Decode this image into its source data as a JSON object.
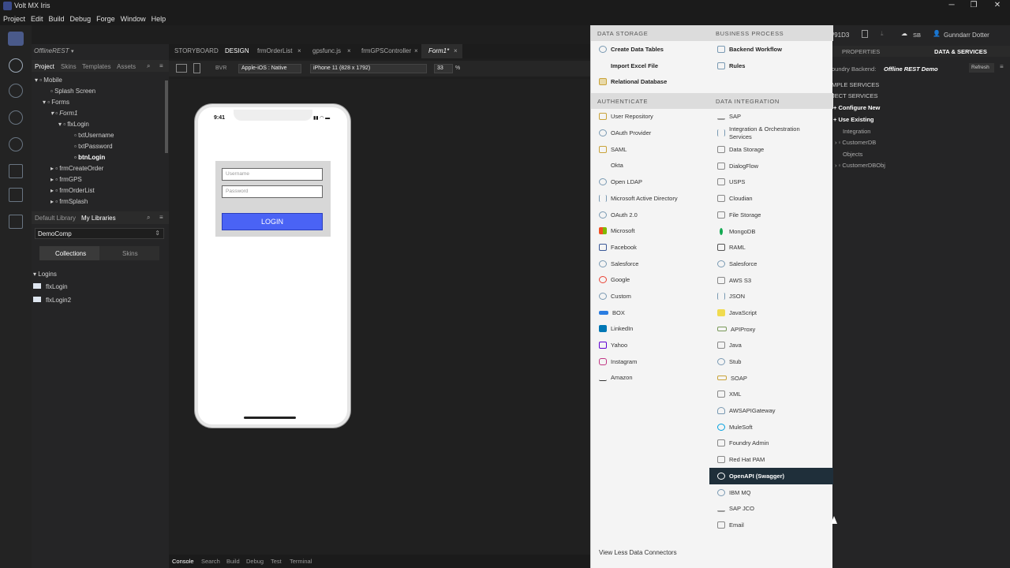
{
  "app": {
    "title": "Volt MX Iris"
  },
  "menu": [
    "Project",
    "Edit",
    "Build",
    "Debug",
    "Forge",
    "Window",
    "Help"
  ],
  "header": {
    "build_id": "/91D3",
    "user_initials": "SB",
    "user_name": "Gunndarr Dotter"
  },
  "project": {
    "name": "OfflineREST"
  },
  "left_tabs": [
    "Project",
    "Skins",
    "Templates",
    "Assets"
  ],
  "tree": [
    "Mobile",
    "Splash Screen",
    "Forms",
    "Form1",
    "flxLogin",
    "txtUsername",
    "txtPassword",
    "btnLogin",
    "frmCreateOrder",
    "frmGPS",
    "frmOrderList",
    "frmSplash"
  ],
  "library_tabs": [
    "Default Library",
    "My Libraries"
  ],
  "library_select": "DemoComp",
  "collection_tabs": [
    "Collections",
    "Skins"
  ],
  "collections": {
    "group": "Logins",
    "items": [
      "flxLogin",
      "flxLogin2"
    ]
  },
  "editor_tabs": [
    "STORYBOARD",
    "DESIGN",
    "frmOrderList",
    "gpsfunc.js",
    "frmGPSController",
    "Form1*"
  ],
  "toolbar": {
    "mode": "BVR",
    "platform": "Apple-iOS : Native",
    "device": "iPhone 11 (828 x 1792)",
    "zoom": "33",
    "zoom_unit": "%"
  },
  "phone": {
    "time": "9:41",
    "username_placeholder": "Username",
    "password_placeholder": "Password",
    "login_label": "LOGIN"
  },
  "bottom_tabs": [
    "Console",
    "Search",
    "Build",
    "Debug",
    "Test",
    "Terminal"
  ],
  "right_panel": {
    "tabs": [
      "PROPERTIES",
      "DATA & SERVICES"
    ],
    "backend_label": "oundry Backend:",
    "backend_name": "Offline REST Demo",
    "refresh": "Refresh",
    "items": [
      "MPLE SERVICES",
      "JECT SERVICES",
      "Configure New",
      "Use Existing",
      "Integration",
      "CustomerDB",
      "Objects",
      "CustomerDBObj"
    ]
  },
  "dropdown": {
    "data_storage": {
      "title": "DATA STORAGE",
      "items": [
        "Create Data Tables",
        "Import Excel File",
        "Relational Database"
      ]
    },
    "business_process": {
      "title": "BUSINESS PROCESS",
      "items": [
        "Backend Workflow",
        "Rules"
      ]
    },
    "authenticate": {
      "title": "AUTHENTICATE",
      "items": [
        "User Repository",
        "OAuth Provider",
        "SAML",
        "Okta",
        "Open LDAP",
        "Microsoft Active Directory",
        "OAuth 2.0",
        "Microsoft",
        "Facebook",
        "Salesforce",
        "Google",
        "Custom",
        "BOX",
        "LinkedIn",
        "Yahoo",
        "Instagram",
        "Amazon"
      ]
    },
    "data_integration": {
      "title": "DATA INTEGRATION",
      "items": [
        "SAP",
        "Integration & Orchestration Services",
        "Data Storage",
        "DialogFlow",
        "USPS",
        "Cloudian",
        "File Storage",
        "MongoDB",
        "RAML",
        "Salesforce",
        "AWS S3",
        "JSON",
        "JavaScript",
        "APIProxy",
        "Java",
        "Stub",
        "SOAP",
        "XML",
        "AWSAPIGateway",
        "MuleSoft",
        "Foundry Admin",
        "Red Hat PAM",
        "OpenAPI (Swagger)",
        "IBM MQ",
        "SAP JCO",
        "Email"
      ],
      "highlighted": "OpenAPI (Swagger)"
    },
    "footer": "View Less Data Connectors"
  },
  "colors": {
    "accent": "#4a63f5",
    "highlight": "#1f2f3a",
    "panel": "#f4f4f4"
  }
}
